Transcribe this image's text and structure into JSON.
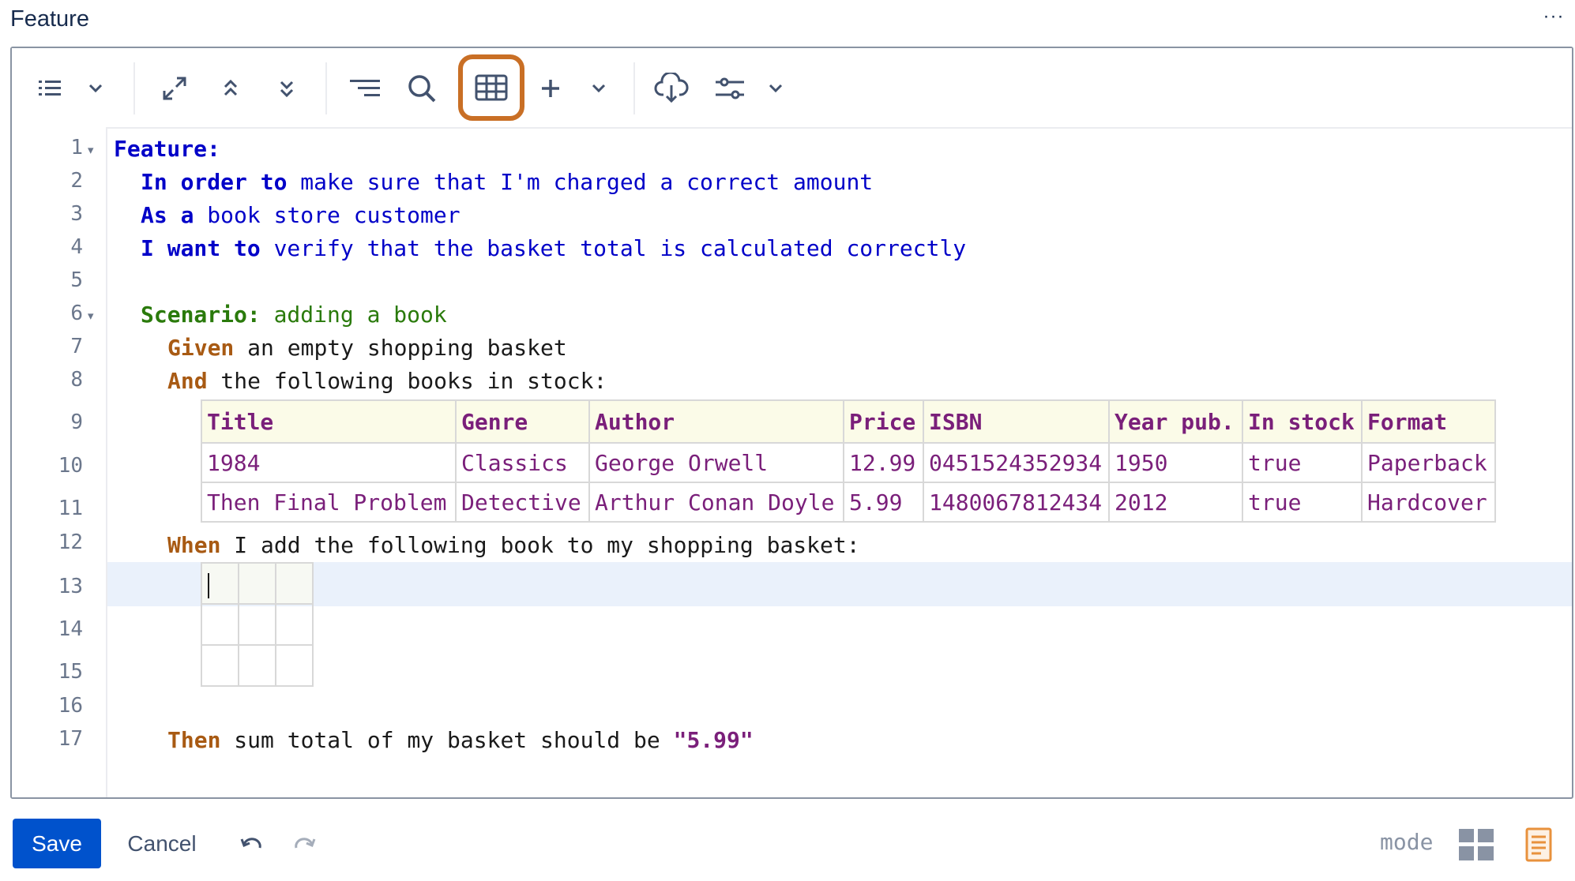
{
  "header": {
    "title": "Feature",
    "more_label": "···"
  },
  "toolbar": {
    "buttons": [
      {
        "name": "list-icon"
      },
      {
        "name": "chevron-down-icon"
      },
      {
        "name": "expand-icon"
      },
      {
        "name": "chevrons-up-icon"
      },
      {
        "name": "chevrons-down-icon"
      },
      {
        "name": "format-lines-icon"
      },
      {
        "name": "search-icon"
      },
      {
        "name": "table-icon",
        "active": true
      },
      {
        "name": "plus-icon"
      },
      {
        "name": "chevron-down-icon"
      },
      {
        "name": "cloud-download-icon"
      },
      {
        "name": "settings-sliders-icon"
      },
      {
        "name": "chevron-down-icon"
      }
    ],
    "accent_color": "#c96f25"
  },
  "editor": {
    "line_numbers": [
      "1",
      "2",
      "3",
      "4",
      "5",
      "6",
      "7",
      "8",
      "9",
      "10",
      "11",
      "12",
      "13",
      "14",
      "15",
      "16",
      "17"
    ],
    "fold_marker": "▾",
    "lines": {
      "l1_kw": "Feature:",
      "l2_kw": "In order to",
      "l2_tx": " make sure that I'm charged a correct amount",
      "l3_kw": "As a",
      "l3_tx": " book store customer",
      "l4_kw": "I want to",
      "l4_tx": " verify that the basket total is calculated correctly",
      "l6_kw": "Scenario:",
      "l6_tx": " adding a book",
      "l7_kw": "Given",
      "l7_tx": " an empty shopping basket",
      "l8_kw": "And",
      "l8_tx": " the following books in stock:",
      "l12_kw": "When",
      "l12_tx": " I add the following book to my shopping basket:",
      "l17_kw": "Then",
      "l17_tx": " sum total of my basket should be ",
      "l17_str": "\"5.99\""
    },
    "stock_table": {
      "headers": [
        "Title",
        "Genre",
        "Author",
        "Price",
        "ISBN",
        "Year pub.",
        "In stock",
        "Format"
      ],
      "rows": [
        [
          "1984",
          "Classics",
          "George Orwell",
          "12.99",
          "0451524352934",
          "1950",
          "true",
          "Paperback"
        ],
        [
          "Then Final Problem",
          "Detective",
          "Arthur Conan Doyle",
          "5.99",
          "1480067812434",
          "2012",
          "true",
          "Hardcover"
        ]
      ]
    }
  },
  "footer": {
    "save_label": "Save",
    "cancel_label": "Cancel",
    "mode_label": "mode"
  }
}
